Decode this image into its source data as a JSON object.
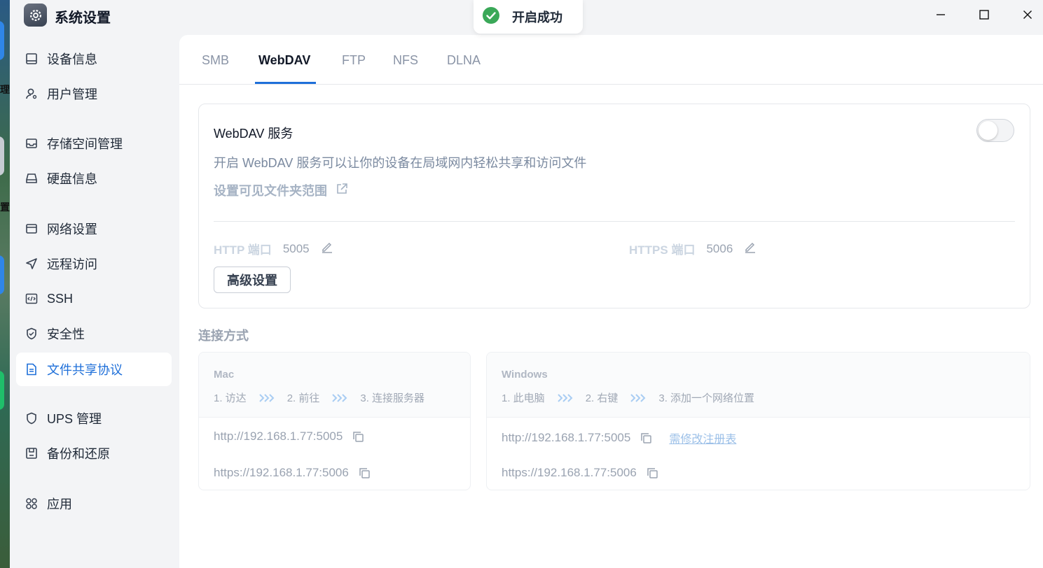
{
  "desktop": {
    "labels": [
      "理",
      "置"
    ]
  },
  "window": {
    "title": "系统设置",
    "controls": [
      "minimize",
      "maximize",
      "close"
    ]
  },
  "toast": {
    "text": "开启成功",
    "icon": "check-circle-icon",
    "color": "#3aa858"
  },
  "sidebar": {
    "items": [
      {
        "label": "设备信息",
        "icon": "device-icon"
      },
      {
        "label": "用户管理",
        "icon": "user-icon"
      },
      {
        "label": "存储空间管理",
        "icon": "storage-icon"
      },
      {
        "label": "硬盘信息",
        "icon": "disk-icon"
      },
      {
        "label": "网络设置",
        "icon": "network-icon"
      },
      {
        "label": "远程访问",
        "icon": "send-icon"
      },
      {
        "label": "SSH",
        "icon": "code-icon"
      },
      {
        "label": "安全性",
        "icon": "shield-check-icon"
      },
      {
        "label": "文件共享协议",
        "icon": "document-icon",
        "active": true
      },
      {
        "label": "UPS 管理",
        "icon": "shield-icon"
      },
      {
        "label": "备份和还原",
        "icon": "save-icon"
      },
      {
        "label": "应用",
        "icon": "apps-icon"
      }
    ]
  },
  "tabs": [
    {
      "label": "SMB"
    },
    {
      "label": "WebDAV",
      "active": true
    },
    {
      "label": "FTP"
    },
    {
      "label": "NFS"
    },
    {
      "label": "DLNA"
    }
  ],
  "webdav": {
    "title": "WebDAV 服务",
    "enabled": false,
    "description": "开启 WebDAV 服务可以让你的设备在局域网内轻松共享和访问文件",
    "folder_link": "设置可见文件夹范围",
    "http_label": "HTTP 端口",
    "http_port": "5005",
    "https_label": "HTTPS 端口",
    "https_port": "5006",
    "advanced_button": "高级设置"
  },
  "connection": {
    "title": "连接方式",
    "mac": {
      "name": "Mac",
      "steps": [
        "1. 访达",
        "2. 前往",
        "3. 连接服务器"
      ],
      "http_url": "http://192.168.1.77:5005",
      "https_url": "https://192.168.1.77:5006"
    },
    "windows": {
      "name": "Windows",
      "steps": [
        "1. 此电脑",
        "2. 右键",
        "3. 添加一个网络位置"
      ],
      "http_url": "http://192.168.1.77:5005",
      "registry_link": "需修改注册表",
      "https_url": "https://192.168.1.77:5006"
    }
  },
  "colors": {
    "accent": "#1e6fd9",
    "success": "#3aa858"
  }
}
